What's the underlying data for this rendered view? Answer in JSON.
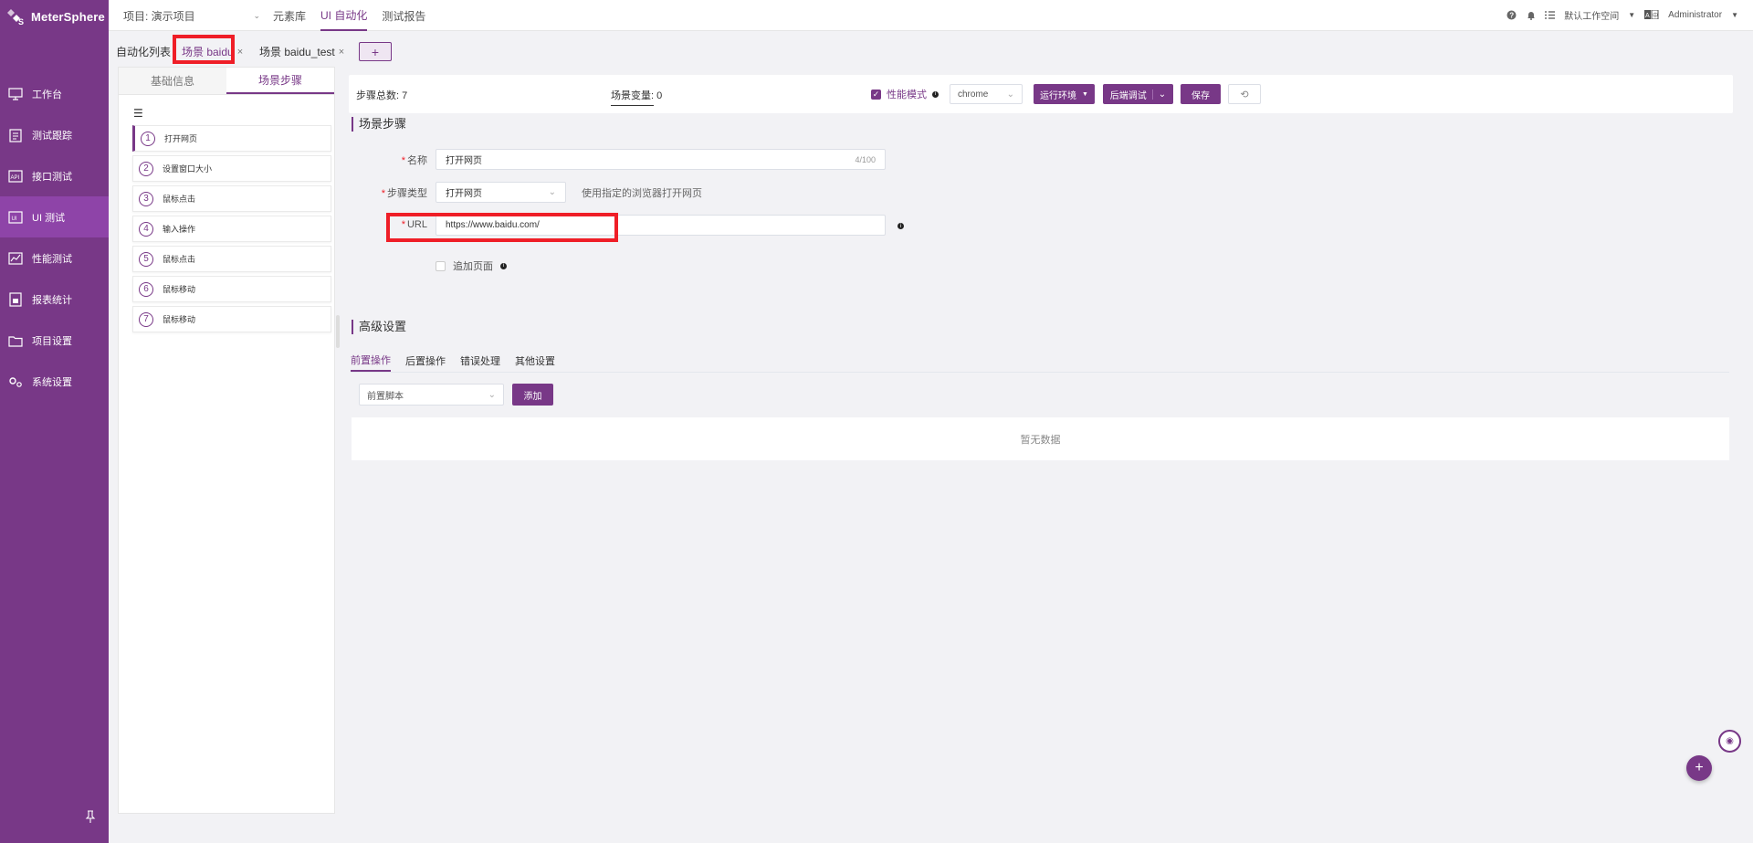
{
  "app": {
    "logo_text": "MeterSphere"
  },
  "sidebar": {
    "items": [
      {
        "label": "工作台",
        "icon": "monitor-icon"
      },
      {
        "label": "测试跟踪",
        "icon": "clipboard-icon"
      },
      {
        "label": "接口测试",
        "icon": "api-icon"
      },
      {
        "label": "UI 测试",
        "icon": "ui-icon",
        "active": true
      },
      {
        "label": "性能测试",
        "icon": "chart-icon"
      },
      {
        "label": "报表统计",
        "icon": "report-icon"
      },
      {
        "label": "项目设置",
        "icon": "folder-icon"
      },
      {
        "label": "系统设置",
        "icon": "gear-icon"
      }
    ]
  },
  "header": {
    "project": "项目: 演示项目",
    "menu": [
      "元素库",
      "UI 自动化",
      "测试报告"
    ],
    "active_menu": "UI 自动化",
    "workspace": "默认工作空间",
    "user": "Administrator"
  },
  "tabs": {
    "list_label": "自动化列表",
    "tab1": "场景 baidu",
    "tab2": "场景 baidu_test",
    "add": "+"
  },
  "steps_panel": {
    "tabs": [
      "基础信息",
      "场景步骤"
    ],
    "active_tab": "场景步骤",
    "steps": [
      {
        "num": "1",
        "label": "打开网页"
      },
      {
        "num": "2",
        "label": "设置窗口大小"
      },
      {
        "num": "3",
        "label": "鼠标点击"
      },
      {
        "num": "4",
        "label": "输入操作"
      },
      {
        "num": "5",
        "label": "鼠标点击"
      },
      {
        "num": "6",
        "label": "鼠标移动"
      },
      {
        "num": "7",
        "label": "鼠标移动"
      }
    ]
  },
  "toolbar": {
    "step_total_label": "步骤总数:",
    "step_total": "7",
    "scene_var_label": "场景变量:",
    "scene_var": "0",
    "perf_mode": "性能模式",
    "browser": "chrome",
    "run_env": "运行环境",
    "debug": "后端调试",
    "save": "保存"
  },
  "form": {
    "section_title": "场景步骤",
    "name_label": "名称",
    "name_value": "打开网页",
    "name_counter": "4/100",
    "type_label": "步骤类型",
    "type_value": "打开网页",
    "type_hint": "使用指定的浏览器打开网页",
    "url_label": "URL",
    "url_value": "https://www.baidu.com/",
    "append_label": "追加页面"
  },
  "advanced": {
    "title": "高级设置",
    "tabs": [
      "前置操作",
      "后置操作",
      "错误处理",
      "其他设置"
    ],
    "script_select": "前置脚本",
    "add_button": "添加",
    "empty": "暂无数据"
  },
  "colors": {
    "brand": "#783887",
    "highlight": "#ef1e27"
  }
}
